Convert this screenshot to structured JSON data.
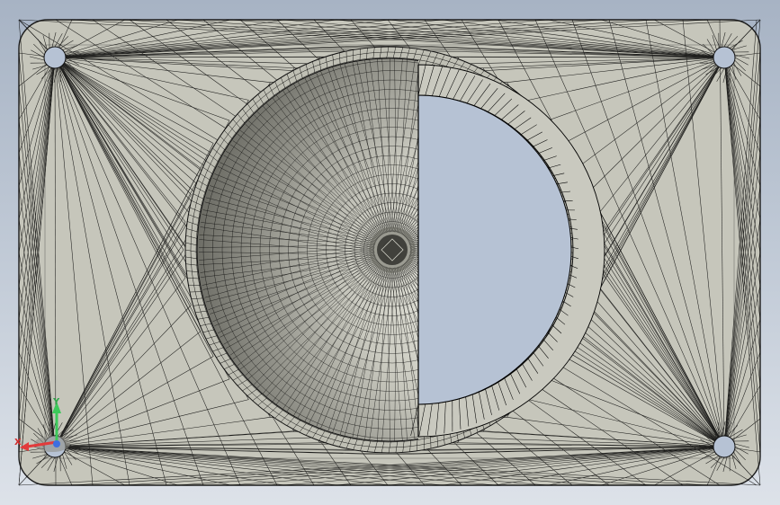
{
  "viewport": {
    "background": "#b6c0ce",
    "plate_color": "#c6c6bb",
    "plate_edge_color": "#1a1a1a",
    "mesh_color": "#000000",
    "cut_face_color": "#b6c2d4",
    "bowl_highlight": "#f3f3ea",
    "bowl_shadow": "#5e5e57"
  },
  "plate": {
    "mounting_holes": 4,
    "hole_icon": "circle-hole-icon"
  },
  "triad": {
    "icon": "coordinate-triad-icon",
    "x_label": "X",
    "y_label": "Y",
    "x_color": "#e23b3b",
    "y_color": "#3cc85a",
    "z_color": "#3d6ee0"
  }
}
